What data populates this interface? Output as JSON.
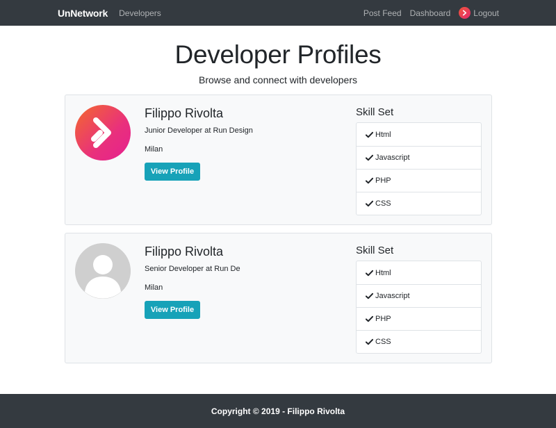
{
  "navbar": {
    "brand": "UnNetwork",
    "left_link": "Developers",
    "right_links": [
      "Post Feed",
      "Dashboard"
    ],
    "logout_label": "Logout"
  },
  "header": {
    "title": "Developer Profiles",
    "lead": "Browse and connect with developers"
  },
  "profiles": [
    {
      "name": "Filippo Rivolta",
      "role": "Junior Developer at Run Design",
      "location": "Milan",
      "button_label": "View Profile",
      "avatar": "brand-logo-icon",
      "skills_title": "Skill Set",
      "skills": [
        "Html",
        "Javascript",
        "PHP",
        "CSS"
      ]
    },
    {
      "name": "Filippo Rivolta",
      "role": "Senior Developer at Run De",
      "location": "Milan",
      "button_label": "View Profile",
      "avatar": "default-user-icon",
      "skills_title": "Skill Set",
      "skills": [
        "Html",
        "Javascript",
        "PHP",
        "CSS"
      ]
    }
  ],
  "footer": {
    "text": "Copyright © 2019 - Filippo Rivolta"
  },
  "colors": {
    "navbar_bg": "#343a40",
    "button_bg": "#17a2b8",
    "card_bg": "#f8f9fa"
  }
}
